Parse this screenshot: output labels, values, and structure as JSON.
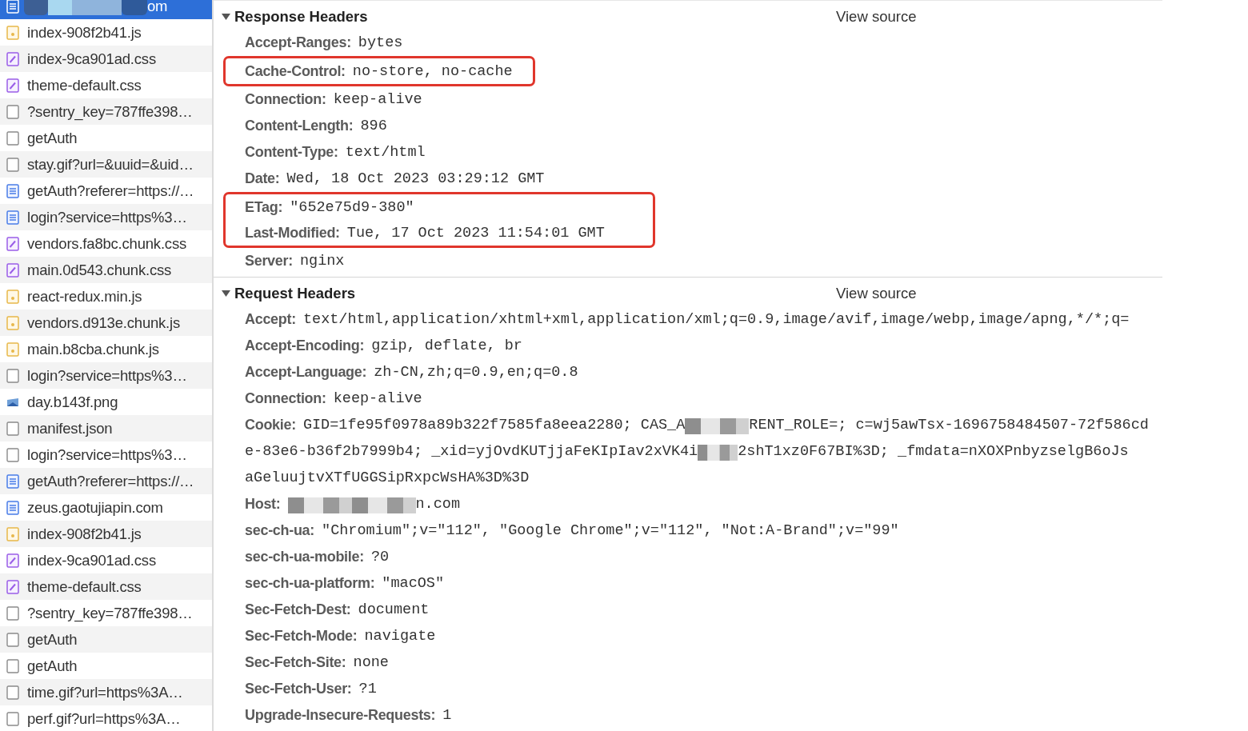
{
  "requests": [
    {
      "name": "om",
      "kind": "doc",
      "selected": true,
      "redacted": true
    },
    {
      "name": "index-908f2b41.js",
      "kind": "js",
      "selected": false
    },
    {
      "name": "index-9ca901ad.css",
      "kind": "css",
      "selected": false
    },
    {
      "name": "theme-default.css",
      "kind": "css",
      "selected": false
    },
    {
      "name": "?sentry_key=787ffe398…",
      "kind": "other",
      "selected": false
    },
    {
      "name": "getAuth",
      "kind": "other",
      "selected": false
    },
    {
      "name": "stay.gif?url=&uuid=&uid…",
      "kind": "other",
      "selected": false
    },
    {
      "name": "getAuth?referer=https://…",
      "kind": "doc",
      "selected": false
    },
    {
      "name": "login?service=https%3…",
      "kind": "doc",
      "selected": false
    },
    {
      "name": "vendors.fa8bc.chunk.css",
      "kind": "css",
      "selected": false
    },
    {
      "name": "main.0d543.chunk.css",
      "kind": "css",
      "selected": false
    },
    {
      "name": "react-redux.min.js",
      "kind": "js",
      "selected": false
    },
    {
      "name": "vendors.d913e.chunk.js",
      "kind": "js",
      "selected": false
    },
    {
      "name": "main.b8cba.chunk.js",
      "kind": "js",
      "selected": false
    },
    {
      "name": "login?service=https%3…",
      "kind": "other",
      "selected": false
    },
    {
      "name": "day.b143f.png",
      "kind": "img",
      "selected": false
    },
    {
      "name": "manifest.json",
      "kind": "other",
      "selected": false
    },
    {
      "name": "login?service=https%3…",
      "kind": "other",
      "selected": false
    },
    {
      "name": "getAuth?referer=https://…",
      "kind": "doc",
      "selected": false
    },
    {
      "name": "zeus.gaotujiapin.com",
      "kind": "doc",
      "selected": false
    },
    {
      "name": "index-908f2b41.js",
      "kind": "js",
      "selected": false
    },
    {
      "name": "index-9ca901ad.css",
      "kind": "css",
      "selected": false
    },
    {
      "name": "theme-default.css",
      "kind": "css",
      "selected": false
    },
    {
      "name": "?sentry_key=787ffe398…",
      "kind": "other",
      "selected": false
    },
    {
      "name": "getAuth",
      "kind": "other",
      "selected": false
    },
    {
      "name": "getAuth",
      "kind": "other",
      "selected": false
    },
    {
      "name": "time.gif?url=https%3A…",
      "kind": "other",
      "selected": false
    },
    {
      "name": "perf.gif?url=https%3A…",
      "kind": "other",
      "selected": false
    }
  ],
  "sections": [
    {
      "title": "Response Headers",
      "expanded": true,
      "view_source": "View source",
      "items": [
        {
          "kind": "header",
          "name": "Accept-Ranges:",
          "value": "bytes"
        },
        {
          "kind": "highlight",
          "wide": false,
          "rows": [
            {
              "kind": "header",
              "name": "Cache-Control:",
              "value": "no-store, no-cache"
            }
          ]
        },
        {
          "kind": "header",
          "name": "Connection:",
          "value": "keep-alive"
        },
        {
          "kind": "header",
          "name": "Content-Length:",
          "value": "896"
        },
        {
          "kind": "header",
          "name": "Content-Type:",
          "value": "text/html"
        },
        {
          "kind": "header",
          "name": "Date:",
          "value": "Wed, 18 Oct 2023 03:29:12 GMT"
        },
        {
          "kind": "highlight",
          "wide": true,
          "rows": [
            {
              "kind": "header",
              "name": "ETag:",
              "value": "\"652e75d9-380\""
            },
            {
              "kind": "header",
              "name": "Last-Modified:",
              "value": "Tue, 17 Oct 2023 11:54:01 GMT"
            }
          ]
        },
        {
          "kind": "header",
          "name": "Server:",
          "value": "nginx"
        }
      ]
    },
    {
      "title": "Request Headers",
      "expanded": true,
      "view_source": "View source",
      "items": [
        {
          "kind": "header",
          "name": "Accept:",
          "value": "text/html,application/xhtml+xml,application/xml;q=0.9,image/avif,image/webp,image/apng,*/*;q="
        },
        {
          "kind": "header",
          "name": "Accept-Encoding:",
          "value": "gzip, deflate, br"
        },
        {
          "kind": "header",
          "name": "Accept-Language:",
          "value": "zh-CN,zh;q=0.9,en;q=0.8"
        },
        {
          "kind": "header",
          "name": "Connection:",
          "value": "keep-alive"
        },
        {
          "kind": "header",
          "name": "Cookie:",
          "lines": [
            [
              "GID=1fe95f0978a89b322f7585fa8eea2280; CAS_A",
              {
                "kind": "redacted",
                "wide": true
              },
              "RENT_ROLE=; c=wj5awTsx-1696758484507-72f586cd"
            ],
            [
              "e-83e6-b36f2b7999b4; _xid=yjOvdKUTjjaFeKIpIav2xVK4i",
              {
                "kind": "redacted",
                "wide": false
              },
              "2shT1xz0F67BI%3D; _fmdata=nXOXPnbyzselgB6oJs"
            ],
            [
              "aGeluujtvXTfUGGSipRxpcWsHA%3D%3D"
            ]
          ]
        },
        {
          "kind": "header",
          "name": "Host:",
          "lines": [
            [
              {
                "kind": "redacted",
                "wide": true
              },
              {
                "kind": "redacted",
                "wide": true
              },
              "n.com"
            ]
          ]
        },
        {
          "kind": "header",
          "name": "sec-ch-ua:",
          "value": "\"Chromium\";v=\"112\", \"Google Chrome\";v=\"112\", \"Not:A-Brand\";v=\"99\""
        },
        {
          "kind": "header",
          "name": "sec-ch-ua-mobile:",
          "value": "?0"
        },
        {
          "kind": "header",
          "name": "sec-ch-ua-platform:",
          "value": "\"macOS\""
        },
        {
          "kind": "header",
          "name": "Sec-Fetch-Dest:",
          "value": "document"
        },
        {
          "kind": "header",
          "name": "Sec-Fetch-Mode:",
          "value": "navigate"
        },
        {
          "kind": "header",
          "name": "Sec-Fetch-Site:",
          "value": "none"
        },
        {
          "kind": "header",
          "name": "Sec-Fetch-User:",
          "value": "?1"
        },
        {
          "kind": "header",
          "name": "Upgrade-Insecure-Requests:",
          "value": "1"
        }
      ]
    }
  ]
}
